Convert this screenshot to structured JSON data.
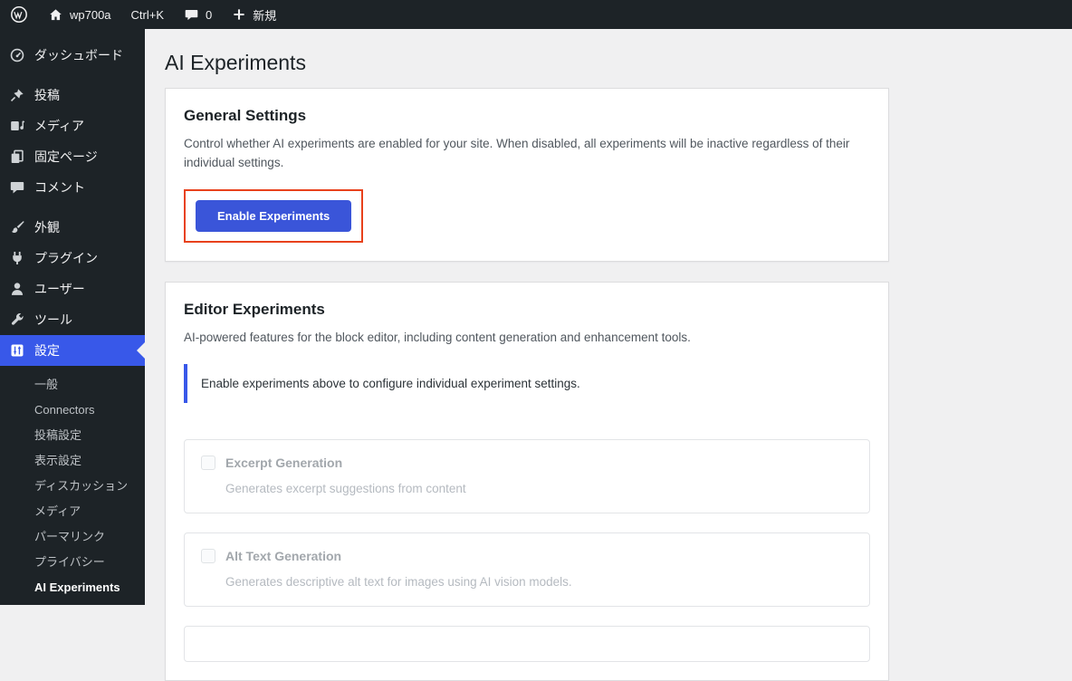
{
  "admin_bar": {
    "site_name": "wp700a",
    "shortcut_label": "Ctrl+K",
    "comments_count": "0",
    "new_label": "新規"
  },
  "sidebar": {
    "items": [
      {
        "label": "ダッシュボード",
        "icon": "dashboard-icon"
      },
      {
        "label": "投稿",
        "icon": "pin-icon"
      },
      {
        "label": "メディア",
        "icon": "media-icon"
      },
      {
        "label": "固定ページ",
        "icon": "pages-icon"
      },
      {
        "label": "コメント",
        "icon": "comment-icon"
      },
      {
        "label": "外観",
        "icon": "appearance-icon"
      },
      {
        "label": "プラグイン",
        "icon": "plugin-icon"
      },
      {
        "label": "ユーザー",
        "icon": "users-icon"
      },
      {
        "label": "ツール",
        "icon": "tools-icon"
      },
      {
        "label": "設定",
        "icon": "settings-icon",
        "active": true
      }
    ],
    "submenu": {
      "items": [
        {
          "label": "一般"
        },
        {
          "label": "Connectors"
        },
        {
          "label": "投稿設定"
        },
        {
          "label": "表示設定"
        },
        {
          "label": "ディスカッション"
        },
        {
          "label": "メディア"
        },
        {
          "label": "パーマリンク"
        },
        {
          "label": "プライバシー"
        },
        {
          "label": "AI Experiments",
          "current": true
        }
      ]
    }
  },
  "page": {
    "title": "AI Experiments",
    "general_settings": {
      "heading": "General Settings",
      "description": "Control whether AI experiments are enabled for your site. When disabled, all experiments will be inactive regardless of their individual settings.",
      "button_label": "Enable Experiments"
    },
    "editor_experiments": {
      "heading": "Editor Experiments",
      "description": "AI-powered features for the block editor, including content generation and enhancement tools.",
      "notice": "Enable experiments above to configure individual experiment settings.",
      "experiments": [
        {
          "label": "Excerpt Generation",
          "description": "Generates excerpt suggestions from content",
          "checked": false,
          "disabled": true
        },
        {
          "label": "Alt Text Generation",
          "description": "Generates descriptive alt text for images using AI vision models.",
          "checked": false,
          "disabled": true
        }
      ]
    }
  },
  "colors": {
    "admin_dark": "#1d2327",
    "accent_blue": "#3858e9",
    "button_blue": "#3a55d9",
    "annotation_red": "#e8411c",
    "page_background": "#f0f0f1"
  }
}
